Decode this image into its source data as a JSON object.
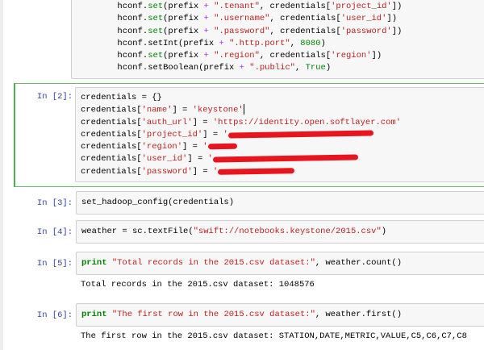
{
  "cells": [
    {
      "prompt": "",
      "lines": [
        [
          [
            "        hconf.",
            ""
          ],
          [
            "set",
            "bi"
          ],
          [
            "(prefix ",
            ""
          ],
          [
            "+",
            "op"
          ],
          [
            " ",
            ""
          ],
          [
            "\".tenant\"",
            "str"
          ],
          [
            ", credentials[",
            ""
          ],
          [
            "'project_id'",
            "str"
          ],
          [
            "])",
            ""
          ]
        ],
        [
          [
            "        hconf.",
            ""
          ],
          [
            "set",
            "bi"
          ],
          [
            "(prefix ",
            ""
          ],
          [
            "+",
            "op"
          ],
          [
            " ",
            ""
          ],
          [
            "\".username\"",
            "str"
          ],
          [
            ", credentials[",
            ""
          ],
          [
            "'user_id'",
            "str"
          ],
          [
            "])",
            ""
          ]
        ],
        [
          [
            "        hconf.",
            ""
          ],
          [
            "set",
            "bi"
          ],
          [
            "(prefix ",
            ""
          ],
          [
            "+",
            "op"
          ],
          [
            " ",
            ""
          ],
          [
            "\".password\"",
            "str"
          ],
          [
            ", credentials[",
            ""
          ],
          [
            "'password'",
            "str"
          ],
          [
            "])",
            ""
          ]
        ],
        [
          [
            "        hconf.setInt(prefix ",
            ""
          ],
          [
            "+",
            "op"
          ],
          [
            " ",
            ""
          ],
          [
            "\".http.port\"",
            "str"
          ],
          [
            ", ",
            ""
          ],
          [
            "8080",
            "num"
          ],
          [
            ")",
            ""
          ]
        ],
        [
          [
            "        hconf.",
            ""
          ],
          [
            "set",
            "bi"
          ],
          [
            "(prefix ",
            ""
          ],
          [
            "+",
            "op"
          ],
          [
            " ",
            ""
          ],
          [
            "\".region\"",
            "str"
          ],
          [
            ", credentials[",
            ""
          ],
          [
            "'region'",
            "str"
          ],
          [
            "])",
            ""
          ]
        ],
        [
          [
            "        hconf.setBoolean(prefix ",
            ""
          ],
          [
            "+",
            "op"
          ],
          [
            " ",
            ""
          ],
          [
            "\".public\"",
            "str"
          ],
          [
            ", ",
            ""
          ],
          [
            "True",
            "bi"
          ],
          [
            ")",
            ""
          ]
        ]
      ]
    },
    {
      "prompt": "In [2]:",
      "lines": [
        [
          [
            "credentials = {}",
            ""
          ]
        ],
        [
          [
            "credentials[",
            ""
          ],
          [
            "'name'",
            "str"
          ],
          [
            "] = ",
            ""
          ],
          [
            "'keystone'",
            "str"
          ],
          [
            "",
            "cursor"
          ]
        ],
        [
          [
            "credentials[",
            ""
          ],
          [
            "'auth_url'",
            "str"
          ],
          [
            "] = ",
            ""
          ],
          [
            "'https://identity.open.softlayer.com'",
            "str"
          ]
        ],
        [
          [
            "credentials[",
            ""
          ],
          [
            "'project_id'",
            "str"
          ],
          [
            "] = ",
            ""
          ],
          [
            "'",
            "str"
          ],
          [
            "180",
            "redact"
          ]
        ],
        [
          [
            "credentials[",
            ""
          ],
          [
            "'region'",
            "str"
          ],
          [
            "] = ",
            ""
          ],
          [
            "'",
            "str"
          ],
          [
            "36",
            "redact"
          ]
        ],
        [
          [
            "credentials[",
            ""
          ],
          [
            "'user_id'",
            "str"
          ],
          [
            "] = ",
            ""
          ],
          [
            "'",
            "str"
          ],
          [
            "180",
            "redact"
          ]
        ],
        [
          [
            "credentials[",
            ""
          ],
          [
            "'password'",
            "str"
          ],
          [
            "] = ",
            ""
          ],
          [
            "'",
            "str"
          ],
          [
            "95",
            "redact"
          ]
        ]
      ]
    },
    {
      "prompt": "In [3]:",
      "lines": [
        [
          [
            "set_hadoop_config(credentials)",
            ""
          ]
        ]
      ]
    },
    {
      "prompt": "In [4]:",
      "lines": [
        [
          [
            "weather = sc.textFile(",
            ""
          ],
          [
            "\"swift://notebooks.keystone/2015.csv\"",
            "str"
          ],
          [
            ")",
            ""
          ]
        ]
      ]
    },
    {
      "prompt": "In [5]:",
      "lines": [
        [
          [
            "print",
            "kw"
          ],
          [
            " ",
            ""
          ],
          [
            "\"Total records in the 2015.csv dataset:\"",
            "str"
          ],
          [
            ", weather.count()",
            ""
          ]
        ]
      ],
      "output": "Total records in the 2015.csv dataset: 1048576"
    },
    {
      "prompt": "In [6]:",
      "lines": [
        [
          [
            "print",
            "kw"
          ],
          [
            " ",
            ""
          ],
          [
            "\"The first row in the 2015.csv dataset:\"",
            "str"
          ],
          [
            ", weather.first()",
            ""
          ]
        ]
      ],
      "output": "The first row in the 2015.csv dataset: STATION,DATE,METRIC,VALUE,C5,C6,C7,C8"
    }
  ]
}
